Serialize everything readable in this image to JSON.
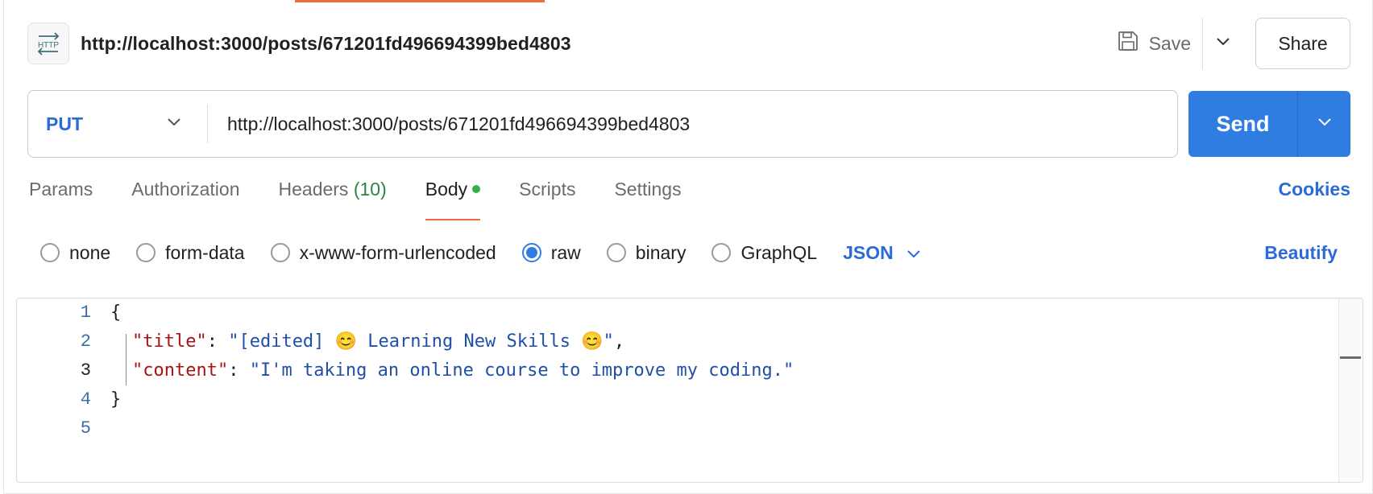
{
  "header": {
    "request_title": "http://localhost:3000/posts/671201fd496694399bed4803",
    "icon": "http-icon",
    "save_label": "Save",
    "share_label": "Share"
  },
  "request": {
    "method": "PUT",
    "url": "http://localhost:3000/posts/671201fd496694399bed4803",
    "send_label": "Send"
  },
  "tabs": [
    {
      "label": "Params"
    },
    {
      "label": "Authorization"
    },
    {
      "label": "Headers",
      "count": "(10)"
    },
    {
      "label": "Body",
      "active": true,
      "indicator": "green-dot"
    },
    {
      "label": "Scripts"
    },
    {
      "label": "Settings"
    }
  ],
  "cookies_label": "Cookies",
  "body_types": {
    "options": [
      "none",
      "form-data",
      "x-www-form-urlencoded",
      "raw",
      "binary",
      "GraphQL"
    ],
    "selected": "raw",
    "language": "JSON",
    "beautify_label": "Beautify"
  },
  "editor": {
    "line_numbers": [
      "1",
      "2",
      "3",
      "4",
      "5"
    ],
    "current_line": 3,
    "lines": {
      "l1": "{",
      "title_key": "\"title\"",
      "title_value": "\"[edited] 😊 Learning New Skills 😊\"",
      "content_key": "\"content\"",
      "content_value": "\"I'm taking an online course to improve my coding.\"",
      "l4": "}"
    }
  },
  "colors": {
    "accent": "#f26b3a",
    "primary": "#2f7de1",
    "link": "#2b6bd8",
    "json_key": "#a31515",
    "json_string": "#1f4fa8",
    "status_dot": "#34b04a"
  }
}
